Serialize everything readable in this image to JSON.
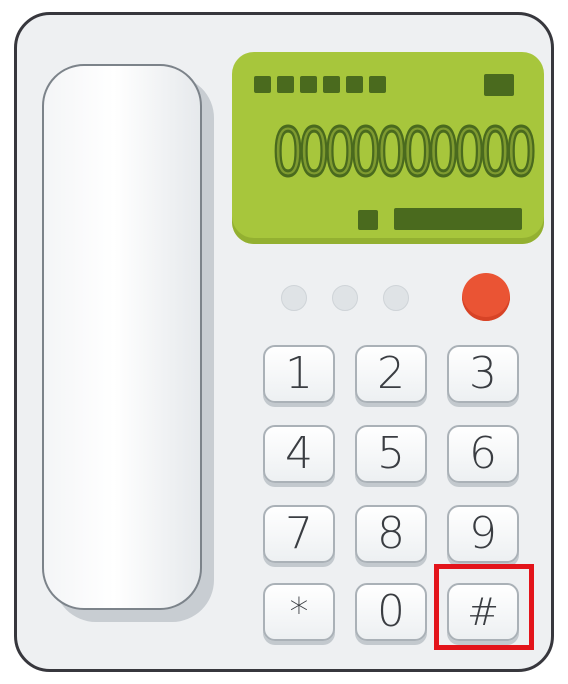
{
  "display": {
    "number": "0000000000"
  },
  "keypad": {
    "keys": [
      "1",
      "2",
      "3",
      "4",
      "5",
      "6",
      "7",
      "8",
      "9",
      "*",
      "0",
      "#"
    ]
  },
  "colors": {
    "lcd_background": "#a7c63c",
    "lcd_ink": "#4a6a1e",
    "red_indicator": "#ea5434",
    "highlight_box": "#e3141b"
  }
}
